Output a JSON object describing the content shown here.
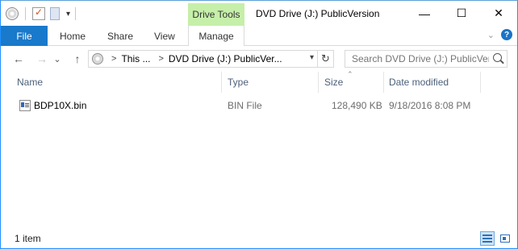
{
  "titlebar": {
    "contextual_tab": "Drive Tools",
    "title": "DVD Drive (J:) PublicVersion",
    "minimize": "—",
    "maximize": "☐",
    "close": "✕"
  },
  "ribbon": {
    "tabs": [
      "File",
      "Home",
      "Share",
      "View",
      "Manage"
    ]
  },
  "navigation": {
    "back": "←",
    "forward": "→",
    "recent": "⌄",
    "up": "↑",
    "breadcrumb": [
      "This ...",
      "DVD Drive (J:) PublicVer..."
    ],
    "refresh": "↻",
    "search_placeholder": "Search DVD Drive (J:) PublicVersion"
  },
  "columns": [
    "Name",
    "Type",
    "Size",
    "Date modified"
  ],
  "files": [
    {
      "name": "BDP10X.bin",
      "type": "BIN File",
      "size": "128,490 KB",
      "date_modified": "9/18/2016 8:08 PM",
      "icon": "bin-file-icon"
    }
  ],
  "status": {
    "item_count": "1 item"
  },
  "colors": {
    "file_tab": "#1979ca",
    "contextual_tab": "#c6efa9",
    "header_text": "#4c607a"
  }
}
